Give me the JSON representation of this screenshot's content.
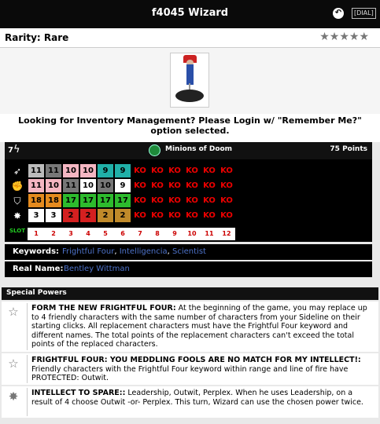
{
  "header": {
    "title": "f4045 Wizard",
    "back_icon": "undo-icon",
    "dial_label": "[DIAL]"
  },
  "rarity": {
    "label": "Rarity: Rare",
    "stars": "★★★★★"
  },
  "login": {
    "message": "Looking for Inventory Management? Please Login w/ \"Remember Me?\" option selected."
  },
  "dial": {
    "range": "7",
    "bolt": "ϟ",
    "team": "Minions of Doom",
    "points": "75 Points",
    "stat_icons": [
      "speed-wing-icon",
      "attack-fist-icon",
      "defense-shield-icon",
      "damage-burst-icon"
    ],
    "slot_label": "SLOT",
    "slots": [
      "1",
      "2",
      "3",
      "4",
      "5",
      "6",
      "7",
      "8",
      "9",
      "10",
      "11",
      "12"
    ],
    "rows": [
      [
        "11",
        "11",
        "10",
        "10",
        "9",
        "9",
        "KO",
        "KO",
        "KO",
        "KO",
        "KO",
        "KO"
      ],
      [
        "11",
        "10",
        "11",
        "10",
        "10",
        "9",
        "KO",
        "KO",
        "KO",
        "KO",
        "KO",
        "KO"
      ],
      [
        "18",
        "18",
        "17",
        "17",
        "17",
        "17",
        "KO",
        "KO",
        "KO",
        "KO",
        "KO",
        "KO"
      ],
      [
        "3",
        "3",
        "2",
        "2",
        "2",
        "2",
        "KO",
        "KO",
        "KO",
        "KO",
        "KO",
        "KO"
      ]
    ],
    "colors": [
      [
        "#bbbbbb",
        "#777777",
        "#f4b6c2",
        "#f4b6c2",
        "#20b0a8",
        "#20b0a8"
      ],
      [
        "#f4b6c2",
        "#f4b6c2",
        "#777777",
        "#ffffff",
        "#777777",
        "#ffffff"
      ],
      [
        "#e58b1f",
        "#e58b1f",
        "#2dbb2d",
        "#2dbb2d",
        "#2dbb2d",
        "#2dbb2d"
      ],
      [
        "#ffffff",
        "#ffffff",
        "#d42020",
        "#d42020",
        "#c08a2a",
        "#c08a2a"
      ]
    ]
  },
  "keywords": {
    "label": "Keywords:",
    "items": [
      "Frightful Four",
      "Intelligencia",
      "Scientist"
    ],
    "sep": ","
  },
  "real_name": {
    "label": "Real Name:",
    "value": "Bentley Wittman"
  },
  "special_powers": {
    "title": "Special Powers",
    "items": [
      {
        "icon": "star-outline-icon",
        "name": "FORM THE NEW FRIGHTFUL FOUR:",
        "text": "At the beginning of the game, you may replace up to 4 friendly characters with the same number of characters from your Sideline on their starting clicks. All replacement characters must have the Frightful Four keyword and different names. The total points of the replacement characters can't exceed the total points of the replaced characters."
      },
      {
        "icon": "star-outline-icon",
        "name": "FRIGHTFUL FOUR: YOU MEDDLING FOOLS ARE NO MATCH FOR MY INTELLECT!:",
        "text": "Friendly characters with the Frightful Four keyword within range and line of fire have PROTECTED: Outwit."
      },
      {
        "icon": "damage-burst-icon",
        "name": "INTELLECT TO SPARE::",
        "text": "Leadership, Outwit, Perplex. When he uses Leadership, on a result of 4 choose Outwit -or- Perplex. This turn, Wizard can use the chosen power twice."
      }
    ]
  }
}
